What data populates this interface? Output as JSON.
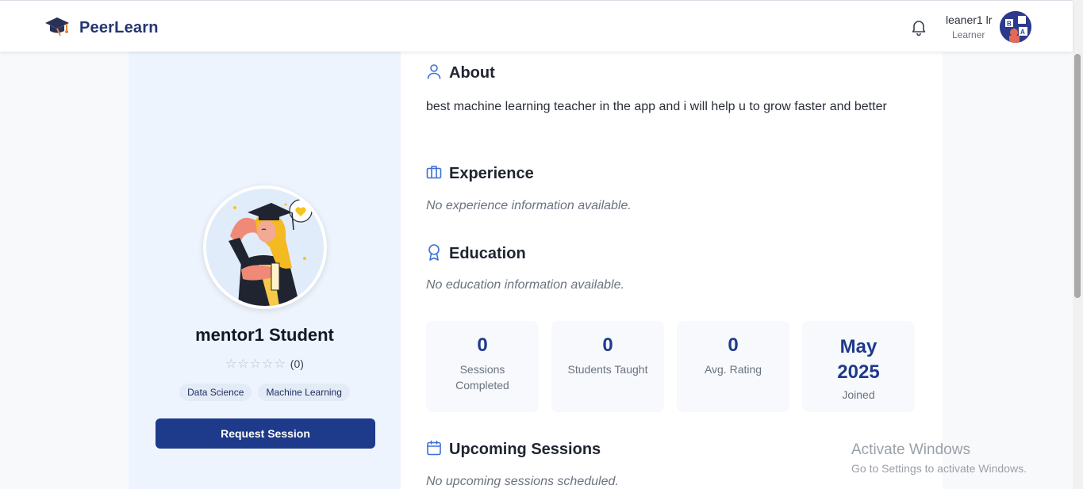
{
  "header": {
    "brand": "PeerLearn",
    "user_name": "leaner1 lr",
    "user_role": "Learner"
  },
  "profile": {
    "name": "mentor1 Student",
    "stars_display": "☆☆☆☆☆",
    "rating_count": "(0)",
    "tags": [
      "Data Science",
      "Machine Learning"
    ],
    "request_button": "Request Session"
  },
  "about": {
    "title": "About",
    "text": "best machine learning teacher in the app and i will help u to grow faster and better"
  },
  "experience": {
    "title": "Experience",
    "empty": "No experience information available."
  },
  "education": {
    "title": "Education",
    "empty": "No education information available."
  },
  "stats": [
    {
      "value": "0",
      "label": "Sessions Completed"
    },
    {
      "value": "0",
      "label": "Students Taught"
    },
    {
      "value": "0",
      "label": "Avg. Rating"
    },
    {
      "value": "May 2025",
      "label": "Joined"
    }
  ],
  "upcoming": {
    "title": "Upcoming Sessions",
    "empty": "No upcoming sessions scheduled."
  },
  "watermark": {
    "line1": "Activate Windows",
    "line2": "Go to Settings to activate Windows."
  },
  "colors": {
    "brand": "#24356f",
    "primary_button": "#1e3a8a",
    "icon_accent": "#3b6fd8"
  },
  "icons": {
    "logo": "graduation-cap-icon",
    "notifications": "bell-icon",
    "about": "user-icon",
    "experience": "briefcase-icon",
    "education": "award-ribbon-icon",
    "upcoming": "calendar-icon"
  }
}
